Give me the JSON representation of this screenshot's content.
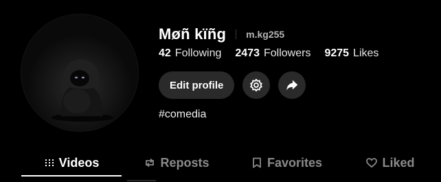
{
  "profile": {
    "display_name": "Møñ kïñg",
    "username": "m.kg255",
    "bio": "#comedia"
  },
  "stats": [
    {
      "value": "42",
      "label": "Following"
    },
    {
      "value": "2473",
      "label": "Followers"
    },
    {
      "value": "9275",
      "label": "Likes"
    }
  ],
  "actions": {
    "edit_profile_label": "Edit profile",
    "settings_icon": "gear-icon",
    "share_icon": "share-arrow-icon"
  },
  "tabs": [
    {
      "label": "Videos",
      "icon": "grid-bars-icon",
      "active": true
    },
    {
      "label": "Reposts",
      "icon": "repost-icon",
      "active": false
    },
    {
      "label": "Favorites",
      "icon": "bookmark-icon",
      "active": false
    },
    {
      "label": "Liked",
      "icon": "heart-outline-icon",
      "active": false
    }
  ],
  "colors": {
    "background": "#000000",
    "button_bg": "#2a2a2a",
    "text_primary": "#ffffff",
    "text_muted": "#8a8a8a"
  }
}
